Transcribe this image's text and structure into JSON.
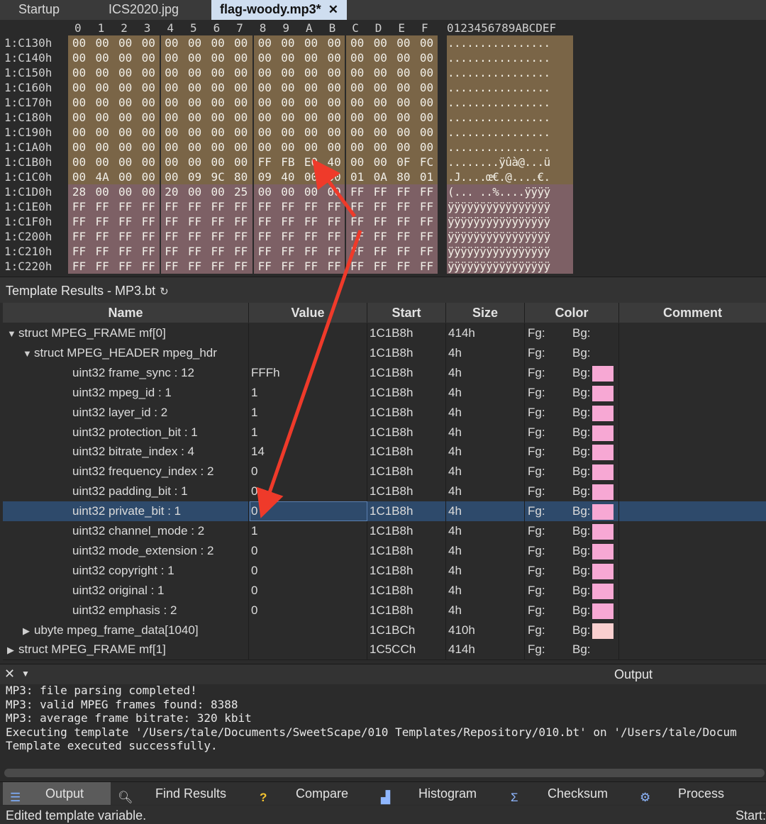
{
  "tabs": [
    {
      "label": "Startup"
    },
    {
      "label": "ICS2020.jpg"
    },
    {
      "label": "flag-woody.mp3*"
    }
  ],
  "hex": {
    "column_header": [
      "0",
      "1",
      "2",
      "3",
      "4",
      "5",
      "6",
      "7",
      "8",
      "9",
      "A",
      "B",
      "C",
      "D",
      "E",
      "F"
    ],
    "ascii_header": "0123456789ABCDEF",
    "rows": [
      {
        "addr": "1:C130h",
        "bytes": [
          "00",
          "00",
          "00",
          "00",
          "00",
          "00",
          "00",
          "00",
          "00",
          "00",
          "00",
          "00",
          "00",
          "00",
          "00",
          "00"
        ],
        "ascii": "................"
      },
      {
        "addr": "1:C140h",
        "bytes": [
          "00",
          "00",
          "00",
          "00",
          "00",
          "00",
          "00",
          "00",
          "00",
          "00",
          "00",
          "00",
          "00",
          "00",
          "00",
          "00"
        ],
        "ascii": "................"
      },
      {
        "addr": "1:C150h",
        "bytes": [
          "00",
          "00",
          "00",
          "00",
          "00",
          "00",
          "00",
          "00",
          "00",
          "00",
          "00",
          "00",
          "00",
          "00",
          "00",
          "00"
        ],
        "ascii": "................"
      },
      {
        "addr": "1:C160h",
        "bytes": [
          "00",
          "00",
          "00",
          "00",
          "00",
          "00",
          "00",
          "00",
          "00",
          "00",
          "00",
          "00",
          "00",
          "00",
          "00",
          "00"
        ],
        "ascii": "................"
      },
      {
        "addr": "1:C170h",
        "bytes": [
          "00",
          "00",
          "00",
          "00",
          "00",
          "00",
          "00",
          "00",
          "00",
          "00",
          "00",
          "00",
          "00",
          "00",
          "00",
          "00"
        ],
        "ascii": "................"
      },
      {
        "addr": "1:C180h",
        "bytes": [
          "00",
          "00",
          "00",
          "00",
          "00",
          "00",
          "00",
          "00",
          "00",
          "00",
          "00",
          "00",
          "00",
          "00",
          "00",
          "00"
        ],
        "ascii": "................"
      },
      {
        "addr": "1:C190h",
        "bytes": [
          "00",
          "00",
          "00",
          "00",
          "00",
          "00",
          "00",
          "00",
          "00",
          "00",
          "00",
          "00",
          "00",
          "00",
          "00",
          "00"
        ],
        "ascii": "................"
      },
      {
        "addr": "1:C1A0h",
        "bytes": [
          "00",
          "00",
          "00",
          "00",
          "00",
          "00",
          "00",
          "00",
          "00",
          "00",
          "00",
          "00",
          "00",
          "00",
          "00",
          "00"
        ],
        "ascii": "................"
      },
      {
        "addr": "1:C1B0h",
        "bytes": [
          "00",
          "00",
          "00",
          "00",
          "00",
          "00",
          "00",
          "00",
          "FF",
          "FB",
          "E0",
          "40",
          "00",
          "00",
          "0F",
          "FC"
        ],
        "ascii": "........ÿûà@...ü"
      },
      {
        "addr": "1:C1C0h",
        "bytes": [
          "00",
          "4A",
          "00",
          "00",
          "00",
          "09",
          "9C",
          "80",
          "09",
          "40",
          "00",
          "00",
          "01",
          "0A",
          "80",
          "01"
        ],
        "ascii": ".J....œ€.@....€."
      },
      {
        "addr": "1:C1D0h",
        "bytes": [
          "28",
          "00",
          "00",
          "00",
          "20",
          "00",
          "00",
          "25",
          "00",
          "00",
          "00",
          "00",
          "FF",
          "FF",
          "FF",
          "FF"
        ],
        "ascii": "(... ..%....ÿÿÿÿ"
      },
      {
        "addr": "1:C1E0h",
        "bytes": [
          "FF",
          "FF",
          "FF",
          "FF",
          "FF",
          "FF",
          "FF",
          "FF",
          "FF",
          "FF",
          "FF",
          "FF",
          "FF",
          "FF",
          "FF",
          "FF"
        ],
        "ascii": "ÿÿÿÿÿÿÿÿÿÿÿÿÿÿÿÿ"
      },
      {
        "addr": "1:C1F0h",
        "bytes": [
          "FF",
          "FF",
          "FF",
          "FF",
          "FF",
          "FF",
          "FF",
          "FF",
          "FF",
          "FF",
          "FF",
          "FF",
          "FF",
          "FF",
          "FF",
          "FF"
        ],
        "ascii": "ÿÿÿÿÿÿÿÿÿÿÿÿÿÿÿÿ"
      },
      {
        "addr": "1:C200h",
        "bytes": [
          "FF",
          "FF",
          "FF",
          "FF",
          "FF",
          "FF",
          "FF",
          "FF",
          "FF",
          "FF",
          "FF",
          "FF",
          "FF",
          "FF",
          "FF",
          "FF"
        ],
        "ascii": "ÿÿÿÿÿÿÿÿÿÿÿÿÿÿÿÿ"
      },
      {
        "addr": "1:C210h",
        "bytes": [
          "FF",
          "FF",
          "FF",
          "FF",
          "FF",
          "FF",
          "FF",
          "FF",
          "FF",
          "FF",
          "FF",
          "FF",
          "FF",
          "FF",
          "FF",
          "FF"
        ],
        "ascii": "ÿÿÿÿÿÿÿÿÿÿÿÿÿÿÿÿ"
      },
      {
        "addr": "1:C220h",
        "bytes": [
          "FF",
          "FF",
          "FF",
          "FF",
          "FF",
          "FF",
          "FF",
          "FF",
          "FF",
          "FF",
          "FF",
          "FF",
          "FF",
          "FF",
          "FF",
          "FF"
        ],
        "ascii": "ÿÿÿÿÿÿÿÿÿÿÿÿÿÿÿÿ"
      }
    ],
    "colors": {
      "zero_region": "#7a6547",
      "ff_region": "#7d6065",
      "selection": "#3c5c8a"
    }
  },
  "template": {
    "title": "Template Results - MP3.bt",
    "columns": [
      "Name",
      "Value",
      "Start",
      "Size",
      "Color",
      "Comment"
    ],
    "rows": [
      {
        "indent": 0,
        "expander": "▼",
        "name": "struct MPEG_FRAME mf[0]",
        "value": "",
        "start": "1C1B8h",
        "size": "414h",
        "fg": "Fg:",
        "bg": "Bg:",
        "swatch": ""
      },
      {
        "indent": 1,
        "expander": "▼",
        "name": "struct MPEG_HEADER mpeg_hdr",
        "value": "",
        "start": "1C1B8h",
        "size": "4h",
        "fg": "Fg:",
        "bg": "Bg:",
        "swatch": ""
      },
      {
        "indent": 2,
        "expander": "",
        "name": "uint32 frame_sync : 12",
        "value": "FFFh",
        "start": "1C1B8h",
        "size": "4h",
        "fg": "Fg:",
        "bg": "Bg:",
        "swatch": "#f7a8d4"
      },
      {
        "indent": 2,
        "expander": "",
        "name": "uint32 mpeg_id : 1",
        "value": "1",
        "start": "1C1B8h",
        "size": "4h",
        "fg": "Fg:",
        "bg": "Bg:",
        "swatch": "#f7a8d4"
      },
      {
        "indent": 2,
        "expander": "",
        "name": "uint32 layer_id : 2",
        "value": "1",
        "start": "1C1B8h",
        "size": "4h",
        "fg": "Fg:",
        "bg": "Bg:",
        "swatch": "#f7a8d4"
      },
      {
        "indent": 2,
        "expander": "",
        "name": "uint32 protection_bit : 1",
        "value": "1",
        "start": "1C1B8h",
        "size": "4h",
        "fg": "Fg:",
        "bg": "Bg:",
        "swatch": "#f7a8d4"
      },
      {
        "indent": 2,
        "expander": "",
        "name": "uint32 bitrate_index : 4",
        "value": "14",
        "start": "1C1B8h",
        "size": "4h",
        "fg": "Fg:",
        "bg": "Bg:",
        "swatch": "#f7a8d4"
      },
      {
        "indent": 2,
        "expander": "",
        "name": "uint32 frequency_index : 2",
        "value": "0",
        "start": "1C1B8h",
        "size": "4h",
        "fg": "Fg:",
        "bg": "Bg:",
        "swatch": "#f7a8d4"
      },
      {
        "indent": 2,
        "expander": "",
        "name": "uint32 padding_bit : 1",
        "value": "0",
        "start": "1C1B8h",
        "size": "4h",
        "fg": "Fg:",
        "bg": "Bg:",
        "swatch": "#f7a8d4"
      },
      {
        "indent": 2,
        "expander": "",
        "name": "uint32 private_bit : 1",
        "value": "0",
        "start": "1C1B8h",
        "size": "4h",
        "fg": "Fg:",
        "bg": "Bg:",
        "swatch": "#f7a8d4",
        "selected": true
      },
      {
        "indent": 2,
        "expander": "",
        "name": "uint32 channel_mode : 2",
        "value": "1",
        "start": "1C1B8h",
        "size": "4h",
        "fg": "Fg:",
        "bg": "Bg:",
        "swatch": "#f7a8d4"
      },
      {
        "indent": 2,
        "expander": "",
        "name": "uint32 mode_extension : 2",
        "value": "0",
        "start": "1C1B8h",
        "size": "4h",
        "fg": "Fg:",
        "bg": "Bg:",
        "swatch": "#f7a8d4"
      },
      {
        "indent": 2,
        "expander": "",
        "name": "uint32 copyright : 1",
        "value": "0",
        "start": "1C1B8h",
        "size": "4h",
        "fg": "Fg:",
        "bg": "Bg:",
        "swatch": "#f7a8d4"
      },
      {
        "indent": 2,
        "expander": "",
        "name": "uint32 original : 1",
        "value": "0",
        "start": "1C1B8h",
        "size": "4h",
        "fg": "Fg:",
        "bg": "Bg:",
        "swatch": "#f7a8d4"
      },
      {
        "indent": 2,
        "expander": "",
        "name": "uint32 emphasis : 2",
        "value": "0",
        "start": "1C1B8h",
        "size": "4h",
        "fg": "Fg:",
        "bg": "Bg:",
        "swatch": "#f7a8d4"
      },
      {
        "indent": 1,
        "expander": "▶",
        "name": "ubyte mpeg_frame_data[1040]",
        "value": "",
        "start": "1C1BCh",
        "size": "410h",
        "fg": "Fg:",
        "bg": "Bg:",
        "swatch": "#f9cfcf"
      },
      {
        "indent": 0,
        "expander": "▶",
        "name": "struct MPEG_FRAME mf[1]",
        "value": "",
        "start": "1C5CCh",
        "size": "414h",
        "fg": "Fg:",
        "bg": "Bg:",
        "swatch": ""
      }
    ]
  },
  "output": {
    "title": "Output",
    "lines": [
      "MP3: file parsing completed!",
      "MP3: valid MPEG frames found: 8388",
      "MP3: average frame bitrate: 320 kbit",
      "Executing template '/Users/tale/Documents/SweetScape/010 Templates/Repository/010.bt' on '/Users/tale/Docum",
      "Template executed successfully."
    ]
  },
  "bottom_tabs": [
    {
      "label": "Output",
      "icon": "output-icon"
    },
    {
      "label": "Find Results",
      "icon": "search-icon"
    },
    {
      "label": "Compare",
      "icon": "question-icon"
    },
    {
      "label": "Histogram",
      "icon": "histogram-icon"
    },
    {
      "label": "Checksum",
      "icon": "sigma-icon"
    },
    {
      "label": "Process",
      "icon": "process-icon"
    }
  ],
  "status": {
    "left": "Edited template variable.",
    "right": "Start:"
  }
}
